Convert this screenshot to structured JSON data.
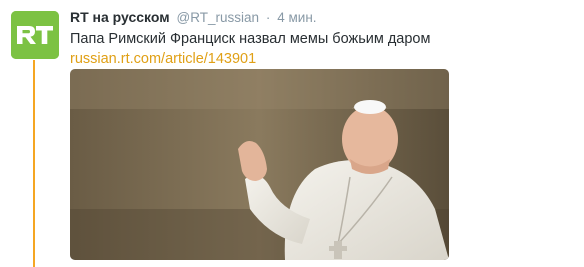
{
  "tweet": {
    "fullname": "RT на русском",
    "username": "@RT_russian",
    "separator": "·",
    "time": "4 мин.",
    "text": "Папа Римский Франциск назвал мемы божьим даром",
    "link": "russian.rt.com/article/143901"
  },
  "avatar": {
    "logo_text": "RT",
    "color": "#7cc243"
  },
  "colors": {
    "thread_line": "#f5a623",
    "link": "#e0a016",
    "muted": "#8899a6",
    "text": "#292f33"
  }
}
